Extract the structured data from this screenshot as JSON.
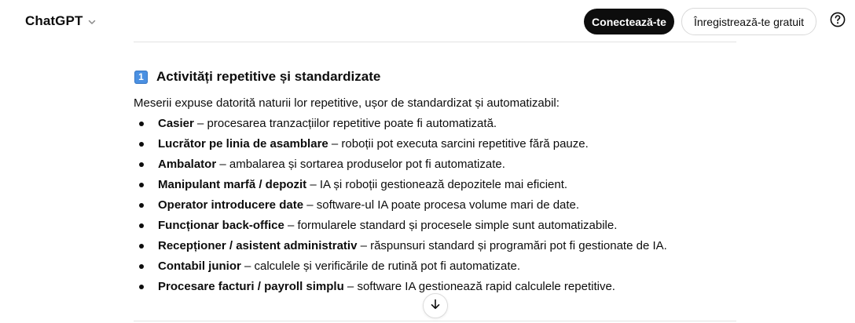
{
  "header": {
    "brand": "ChatGPT",
    "login_label": "Conectează-te",
    "signup_label": "Înregistrează-te gratuit"
  },
  "content": {
    "section_number": "1",
    "heading": "Activități repetitive și standardizate",
    "intro": "Meserii expuse datorită naturii lor repetitive, ușor de standardizat și automatizabil:",
    "items": [
      {
        "term": "Casier",
        "desc": " – procesarea tranzacțiilor repetitive poate fi automatizată."
      },
      {
        "term": "Lucrător pe linia de asamblare",
        "desc": " – roboții pot executa sarcini repetitive fără pauze."
      },
      {
        "term": "Ambalator",
        "desc": " – ambalarea și sortarea produselor pot fi automatizate."
      },
      {
        "term": "Manipulant marfă / depozit",
        "desc": " – IA și roboții gestionează depozitele mai eficient."
      },
      {
        "term": "Operator introducere date",
        "desc": " – software-ul IA poate procesa volume mari de date."
      },
      {
        "term": "Funcționar back-office",
        "desc": " – formularele standard și procesele simple sunt automatizabile."
      },
      {
        "term": "Recepționer / asistent administrativ",
        "desc": " – răspunsuri standard și programări pot fi gestionate de IA."
      },
      {
        "term": "Contabil junior",
        "desc": " – calculele și verificările de rutină pot fi automatizate."
      },
      {
        "term": "Procesare facturi / payroll simplu",
        "desc": " – software IA gestionează rapid calculele repetitive."
      }
    ]
  },
  "icons": {
    "brand_chevron": "chevron-down-icon",
    "help": "question-circle-icon",
    "scroll": "arrow-down-icon"
  },
  "colors": {
    "primary_button": "#0d0d0d",
    "keycap": "#4a90e2",
    "divider": "#e3e3e3"
  }
}
